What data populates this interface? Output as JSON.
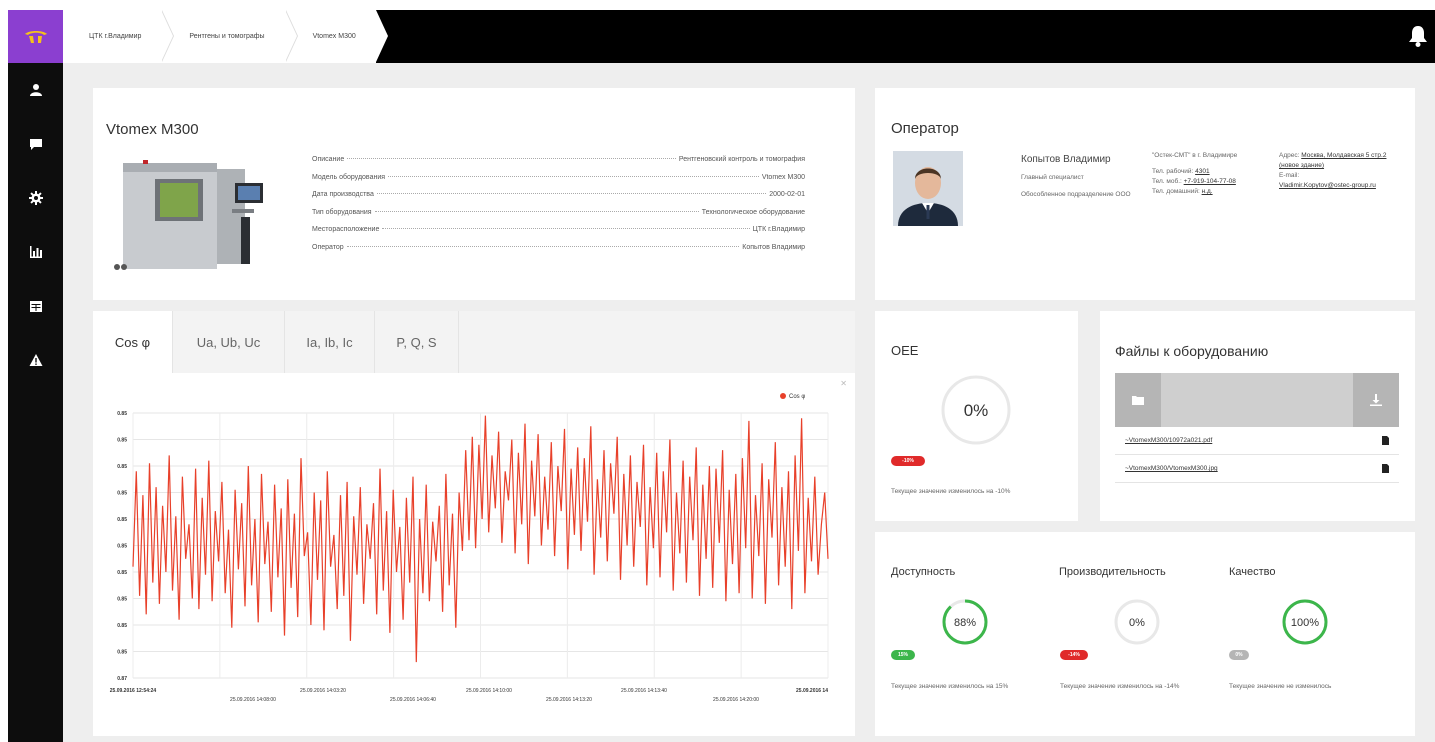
{
  "sidebar": {
    "logo": "logo-icon",
    "items": [
      {
        "icon": "user-icon"
      },
      {
        "icon": "chat-icon"
      },
      {
        "icon": "gear-icon"
      },
      {
        "icon": "bar-chart-icon"
      },
      {
        "icon": "calendar-icon"
      },
      {
        "icon": "warning-icon"
      }
    ]
  },
  "breadcrumbs": [
    "ЦТК г.Владимир",
    "Рентгены и томографы",
    "Vtomex M300"
  ],
  "equipment": {
    "title": "Vtomex M300",
    "rows": [
      {
        "key": "Описание",
        "value": "Рентгеновский контроль и томография"
      },
      {
        "key": "Модель оборудования",
        "value": "Vtomex M300"
      },
      {
        "key": "Дата производства",
        "value": "2000-02-01"
      },
      {
        "key": "Тип оборудования",
        "value": "Технологическое оборудование"
      },
      {
        "key": "Месторасположение",
        "value": "ЦТК г.Владимир"
      },
      {
        "key": "Оператор",
        "value": "Копытов Владимир"
      }
    ]
  },
  "operator": {
    "title": "Оператор",
    "name": "Копытов Владимир",
    "role": "Главный специалист",
    "department": "Обособленное подразделение ООО",
    "org": "\"Остек-СМТ\" в г. Владимире",
    "phone_work_label": "Тел. рабочий:",
    "phone_work": "4301",
    "phone_mobile_label": "Тел. моб.:",
    "phone_mobile": "+7-919-104-77-08",
    "phone_home_label": "Тел. домашний:",
    "phone_home": "н.д.",
    "address_label": "Адрес:",
    "address": "Москва, Молдавская 5 стр.2 (новое здание)",
    "email_label": "E-mail:",
    "email": "Vladimir.Kopytov@ostec-group.ru"
  },
  "chart_tabs": [
    "Cos φ",
    "Ua, Ub, Uc",
    "Ia, Ib, Ic",
    "P, Q, S"
  ],
  "chart_data": {
    "type": "line",
    "title": "",
    "xlabel": "",
    "ylabel": "",
    "legend": "top-right",
    "series_name": "Cos φ",
    "series_color": "#e8402a",
    "y_tick_labels": [
      "0.85",
      "0.85",
      "0.85",
      "0.85",
      "0.85",
      "0.85",
      "0.85",
      "0.85",
      "0.85",
      "0.85",
      "0.87"
    ],
    "x_tick_labels_top": [
      "25.09.2016 12:54:24",
      "25.09.2016 14:03:20",
      "25.09.2016 14:10:00",
      "25.09.2016 14:13:40",
      "25.09.2016 14"
    ],
    "x_tick_labels_bottom": [
      "25.09.2016 14:08:00",
      "25.09.2016 14:06:40",
      "25.09.2016 14:13:20",
      "25.09.2016 14:20:00"
    ],
    "ylim": [
      0,
      10
    ],
    "grid": true,
    "series": [
      {
        "name": "Cos φ",
        "values": [
          4.2,
          7.8,
          3.1,
          6.9,
          2.4,
          8.1,
          3.6,
          7.2,
          2.8,
          6.5,
          4.0,
          8.4,
          3.3,
          6.1,
          2.2,
          7.6,
          4.5,
          5.8,
          3.0,
          7.9,
          2.6,
          6.8,
          3.9,
          8.2,
          2.9,
          6.3,
          4.4,
          7.4,
          3.2,
          5.6,
          1.9,
          7.1,
          4.1,
          6.6,
          2.7,
          8.0,
          3.5,
          6.0,
          2.1,
          7.7,
          4.3,
          5.9,
          2.5,
          7.3,
          3.8,
          6.4,
          1.6,
          7.5,
          3.4,
          6.2,
          2.3,
          8.3,
          4.6,
          5.5,
          2.0,
          7.0,
          3.7,
          6.7,
          1.8,
          7.8,
          4.2,
          5.4,
          2.6,
          6.9,
          3.1,
          7.4,
          1.4,
          6.1,
          3.9,
          7.2,
          2.8,
          5.8,
          4.5,
          6.6,
          2.4,
          7.9,
          3.3,
          6.3,
          1.7,
          7.1,
          4.0,
          5.7,
          2.2,
          6.8,
          3.6,
          7.6,
          0.6,
          6.0,
          3.2,
          7.3,
          2.9,
          5.9,
          4.4,
          6.5,
          2.5,
          7.7,
          3.5,
          6.2,
          1.9,
          7.0,
          4.8,
          8.6,
          5.2,
          9.1,
          4.9,
          8.8,
          6.0,
          9.9,
          5.5,
          8.4,
          6.4,
          9.3,
          5.1,
          7.8,
          6.7,
          9.0,
          4.7,
          8.5,
          5.8,
          9.6,
          4.3,
          8.2,
          6.1,
          9.2,
          5.0,
          7.6,
          5.6,
          8.9,
          4.6,
          8.0,
          6.3,
          9.4,
          4.1,
          7.9,
          5.4,
          8.7,
          4.8,
          8.3,
          5.9,
          9.5,
          3.9,
          7.5,
          5.3,
          8.6,
          4.4,
          8.1,
          6.2,
          9.1,
          3.7,
          7.7,
          5.0,
          8.4,
          4.2,
          7.4,
          5.7,
          8.8,
          3.5,
          7.2,
          4.9,
          8.5,
          3.8,
          7.8,
          5.5,
          9.0,
          3.3,
          7.0,
          4.7,
          8.2,
          3.6,
          7.6,
          5.2,
          8.7,
          3.1,
          7.3,
          4.5,
          8.0,
          3.4,
          7.9,
          5.1,
          8.6,
          2.9,
          7.1,
          4.3,
          7.7,
          3.2,
          8.3,
          4.9,
          9.7,
          3.0,
          6.9,
          4.6,
          8.1,
          2.8,
          7.5,
          5.3,
          8.9,
          3.5,
          7.2,
          4.2,
          7.8,
          2.6,
          8.4,
          4.8,
          9.8,
          3.2,
          6.8,
          4.4,
          7.6,
          3.9,
          5.8,
          7.0,
          4.5
        ]
      }
    ]
  },
  "oee": {
    "title": "OEE",
    "value_text": "0%",
    "value": 0,
    "badge": "-10%",
    "badge_color": "#e02a2a",
    "note": "Текущее значение изменилось на -10%"
  },
  "files": {
    "title": "Файлы к оборудованию",
    "items": [
      {
        "name": "~VtomexM300/10972a021.pdf"
      },
      {
        "name": "~VtomexM300/VtomexM300.jpg"
      }
    ]
  },
  "kpis": [
    {
      "title": "Доступность",
      "value_text": "88%",
      "value": 88,
      "badge": "15%",
      "badge_color": "#3cb64b",
      "note": "Текущее значение изменилось на 15%"
    },
    {
      "title": "Производительность",
      "value_text": "0%",
      "value": 0,
      "badge": "-14%",
      "badge_color": "#e02a2a",
      "note": "Текущее значение изменилось на -14%"
    },
    {
      "title": "Качество",
      "value_text": "100%",
      "value": 100,
      "badge": "0%",
      "badge_color": "#b5b5b5",
      "note": "Текущее значение не изменилось"
    }
  ],
  "colors": {
    "accent": "#8b3fd0",
    "sidebar": "#0d0d0d",
    "gauge_green": "#3cb64b",
    "gauge_track": "#e8e8e8"
  }
}
